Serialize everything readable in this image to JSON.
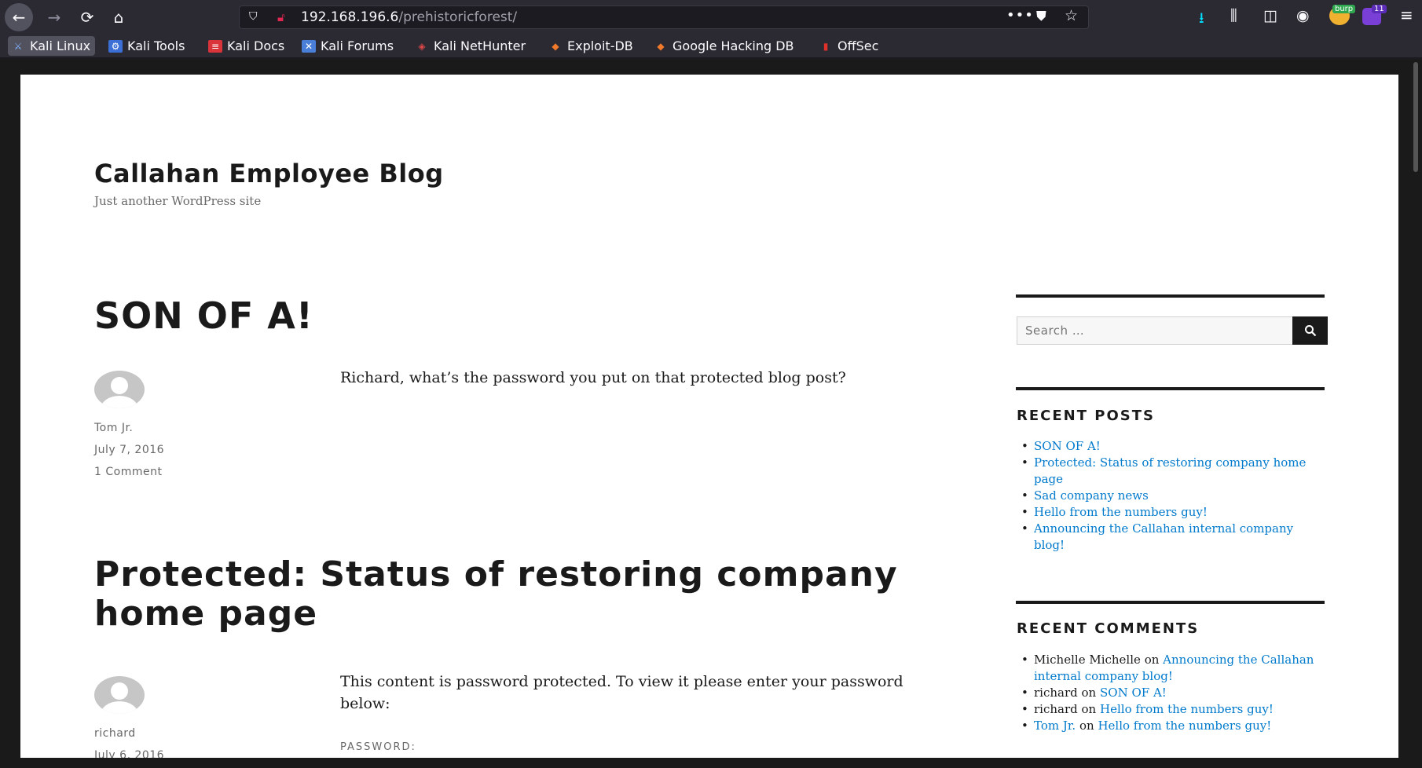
{
  "browser": {
    "url_host": "192.168.196.6",
    "url_path": "/prehistoricforest/",
    "icons": {
      "back": "back-arrow-icon",
      "forward": "forward-arrow-icon",
      "reload": "reload-icon",
      "home": "home-icon",
      "shield": "tracking-shield-icon",
      "lock": "insecure-lock-icon",
      "more": "more-dots-icon",
      "pocket": "pocket-icon",
      "star": "bookmark-star-icon",
      "downloads": "download-arrow-icon",
      "library": "library-icon",
      "sidebar": "sidebar-icon",
      "account": "account-icon",
      "menu": "hamburger-menu-icon"
    },
    "burp_badge": "burp",
    "extension_badge": "11",
    "accent_color": "#00ddff"
  },
  "bookmarks": [
    {
      "label": "Kali Linux",
      "icon": "kali-dragon-icon"
    },
    {
      "label": "Kali Tools",
      "icon": "kali-tools-icon"
    },
    {
      "label": "Kali Docs",
      "icon": "kali-docs-icon"
    },
    {
      "label": "Kali Forums",
      "icon": "kali-forums-icon"
    },
    {
      "label": "Kali NetHunter",
      "icon": "nethunter-icon"
    },
    {
      "label": "Exploit-DB",
      "icon": "exploit-db-icon"
    },
    {
      "label": "Google Hacking DB",
      "icon": "ghdb-icon"
    },
    {
      "label": "OffSec",
      "icon": "offsec-icon"
    }
  ],
  "site": {
    "title": "Callahan Employee Blog",
    "description": "Just another WordPress site"
  },
  "posts": [
    {
      "title": "SON OF A!",
      "author": "Tom Jr.",
      "date": "July 7, 2016",
      "comments": "1 Comment",
      "body": "Richard, what’s the password you put on that protected blog post?"
    },
    {
      "title": "Protected: Status of restoring com­pany home page",
      "author": "richard",
      "date": "July 6, 2016",
      "body": "This content is password protected. To view it please enter your password below:",
      "password_label": "PASSWORD:"
    }
  ],
  "sidebar": {
    "search_placeholder": "Search …",
    "recent_posts_title": "RECENT POSTS",
    "recent_posts": [
      "SON OF A!",
      "Protected: Status of restoring company home page",
      "Sad company news",
      "Hello from the numbers guy!",
      "Announcing the Callahan internal company blog!"
    ],
    "recent_comments_title": "RECENT COMMENTS",
    "recent_comments": [
      {
        "author": "Michelle Michelle",
        "on": "on",
        "post": "Announcing the Callahan internal company blog!"
      },
      {
        "author": "richard",
        "on": "on",
        "post": "SON OF A!"
      },
      {
        "author": "richard",
        "on": "on",
        "post": "Hello from the numbers guy!"
      },
      {
        "author": "Tom Jr.",
        "on": "on",
        "post": "Hello from the numbers guy!",
        "author_link": true
      }
    ],
    "link_color": "#007acc"
  }
}
